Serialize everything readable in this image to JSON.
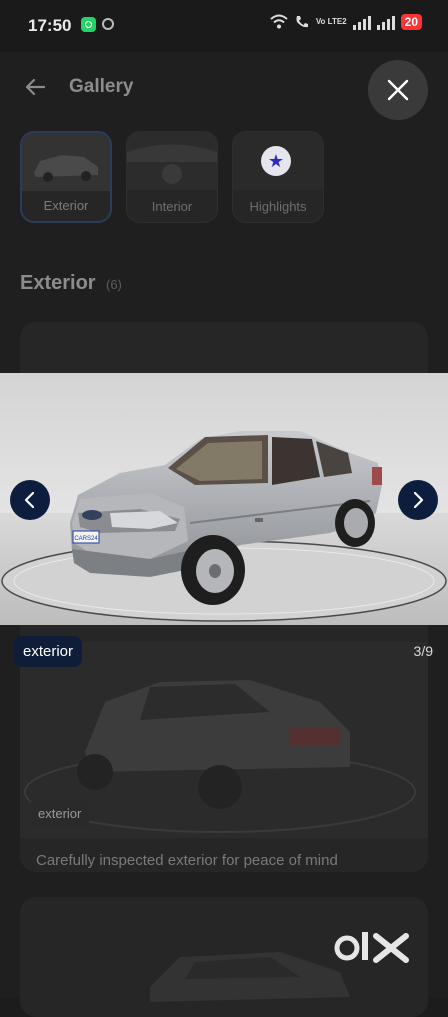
{
  "status_bar": {
    "time": "17:50",
    "battery": "20",
    "network": "Vo LTE2"
  },
  "header": {
    "title": "Gallery"
  },
  "tabs": [
    {
      "label": "Exterior",
      "active": true
    },
    {
      "label": "Interior",
      "active": false
    },
    {
      "label": "Highlights",
      "active": false
    }
  ],
  "section": {
    "title": "Exterior",
    "count": "(6)"
  },
  "background_card": {
    "badge": "exterior",
    "caption": "Carefully inspected exterior for peace of mind"
  },
  "viewer": {
    "label": "exterior",
    "counter": "3/9",
    "plate": "CARS24"
  },
  "branding": {
    "watermark": "OLX"
  },
  "colors": {
    "accent": "#0c1d3e",
    "battery": "#ff3333"
  }
}
